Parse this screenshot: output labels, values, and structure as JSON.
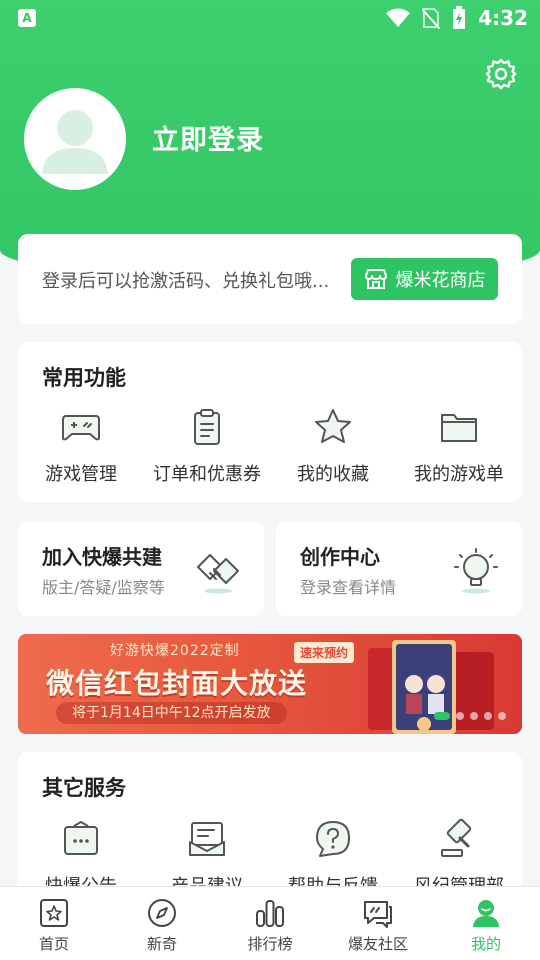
{
  "status": {
    "time": "4:32",
    "app_badge": "A"
  },
  "profile": {
    "login_label": "立即登录"
  },
  "login_card": {
    "tip": "登录后可以抢激活码、兑换礼包哦...",
    "shop_button": "爆米花商店"
  },
  "features": {
    "title": "常用功能",
    "items": [
      {
        "label": "游戏管理",
        "icon": "gamepad-icon"
      },
      {
        "label": "订单和优惠券",
        "icon": "clipboard-icon"
      },
      {
        "label": "我的收藏",
        "icon": "star-icon"
      },
      {
        "label": "我的游戏单",
        "icon": "folder-icon"
      }
    ]
  },
  "cards": {
    "join": {
      "title": "加入快爆共建",
      "subtitle": "版主/答疑/监察等",
      "icon": "handshake-icon"
    },
    "create": {
      "title": "创作中心",
      "subtitle": "登录查看详情",
      "icon": "lightbulb-icon"
    }
  },
  "banner": {
    "top_text": "好游快爆2022定制",
    "tag": "速来预约",
    "main_text": "微信红包封面大放送",
    "sub_text": "将于1月14日中午12点开启发放",
    "dots": 5,
    "active_dot": 0
  },
  "other": {
    "title": "其它服务",
    "items": [
      {
        "label": "快爆公告",
        "icon": "announcement-icon"
      },
      {
        "label": "产品建议",
        "icon": "suggestion-icon"
      },
      {
        "label": "帮助与反馈",
        "icon": "help-icon"
      },
      {
        "label": "风纪管理部",
        "icon": "gavel-icon"
      }
    ]
  },
  "tabbar": {
    "items": [
      {
        "label": "首页",
        "icon": "home-icon"
      },
      {
        "label": "新奇",
        "icon": "compass-icon"
      },
      {
        "label": "排行榜",
        "icon": "ranking-icon"
      },
      {
        "label": "爆友社区",
        "icon": "community-icon"
      },
      {
        "label": "我的",
        "icon": "profile-icon"
      }
    ],
    "active": 4
  },
  "colors": {
    "brand_green": "#2fc463",
    "banner_red": "#e0493a"
  }
}
